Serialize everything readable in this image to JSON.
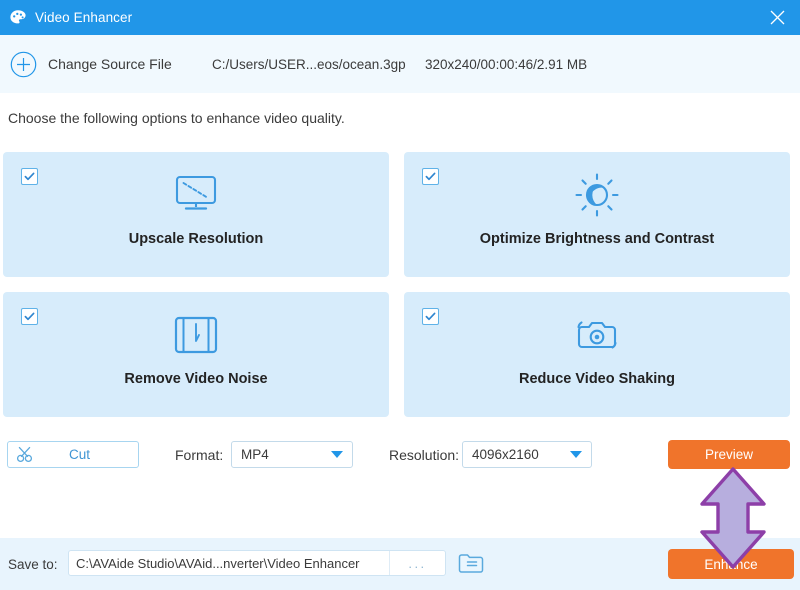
{
  "window": {
    "title": "Video Enhancer",
    "logo_icon": "palette-icon",
    "close_icon": "close-icon",
    "titlebar_color": "#2196e8"
  },
  "source_bar": {
    "add_icon": "plus-circle-icon",
    "change_label": "Change Source File",
    "path": "C:/Users/USER...eos/ocean.3gp",
    "meta": "320x240/00:00:46/2.91 MB"
  },
  "instruction": "Choose the following options to enhance video quality.",
  "options": [
    {
      "label": "Upscale Resolution",
      "icon": "monitor-upscale-icon",
      "checked": true
    },
    {
      "label": "Optimize Brightness and Contrast",
      "icon": "sun-contrast-icon",
      "checked": true
    },
    {
      "label": "Remove Video Noise",
      "icon": "film-strip-icon",
      "checked": true
    },
    {
      "label": "Reduce Video Shaking",
      "icon": "camera-motion-icon",
      "checked": true
    }
  ],
  "controls": {
    "cut_label": "Cut",
    "cut_icon": "scissors-icon",
    "format_label": "Format:",
    "format_value": "MP4",
    "resolution_label": "Resolution:",
    "resolution_value": "4096x2160",
    "dropdown_icon": "chevron-down-icon",
    "preview_label": "Preview"
  },
  "footer": {
    "saveto_label": "Save to:",
    "saveto_path": "C:\\AVAide Studio\\AVAid...nverter\\Video Enhancer",
    "browse_ellipsis": "...",
    "folder_icon": "open-folder-icon",
    "enhance_label": "Enhance"
  },
  "annotation": {
    "icon": "double-arrow-up-down-icon",
    "fill": "#b7aede",
    "stroke": "#8d3fa8"
  },
  "colors": {
    "accent_blue": "#2196e8",
    "card_blue": "#d7ecfb",
    "primary_orange": "#f0742b",
    "footer_blue": "#e8f4fd"
  }
}
